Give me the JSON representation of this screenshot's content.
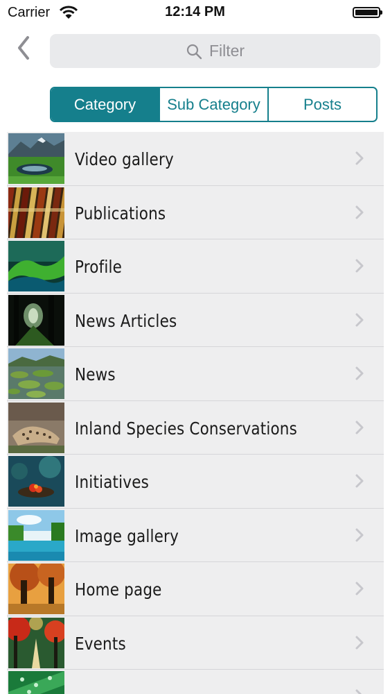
{
  "status_bar": {
    "carrier": "Carrier",
    "time": "12:14 PM"
  },
  "search": {
    "placeholder": "Filter"
  },
  "tabs": [
    {
      "label": "Category",
      "active": true
    },
    {
      "label": "Sub Category",
      "active": false
    },
    {
      "label": "Posts",
      "active": false
    }
  ],
  "list": {
    "items": [
      {
        "label": "Video gallery",
        "thumbnail": "mountain-lake-photo"
      },
      {
        "label": "Publications",
        "thumbnail": "books-photo"
      },
      {
        "label": "Profile",
        "thumbnail": "green-wave-photo"
      },
      {
        "label": "News Articles",
        "thumbnail": "dark-forest-photo"
      },
      {
        "label": "News",
        "thumbnail": "lily-pads-photo"
      },
      {
        "label": "Inland Species Conservations",
        "thumbnail": "leopard-photo"
      },
      {
        "label": "Initiatives",
        "thumbnail": "red-flower-photo"
      },
      {
        "label": "Image gallery",
        "thumbnail": "waterfall-lake-photo"
      },
      {
        "label": "Home page",
        "thumbnail": "autumn-trees-photo"
      },
      {
        "label": "Events",
        "thumbnail": "red-forest-road-photo"
      },
      {
        "label": "",
        "thumbnail": "green-droplets-photo"
      }
    ]
  },
  "colors": {
    "accent": "#157f8c",
    "list_background": "#eeeeef"
  }
}
